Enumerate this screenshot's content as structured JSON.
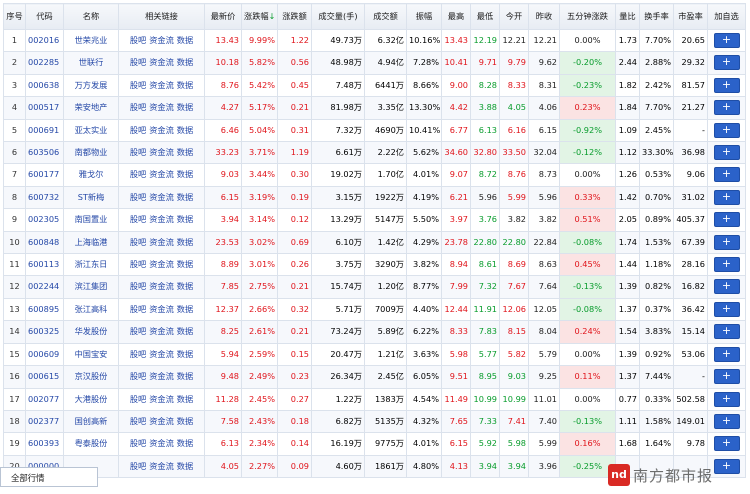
{
  "headers": [
    "序号",
    "代码",
    "名称",
    "相关链接",
    "最新价",
    "涨跌幅",
    "涨跌额",
    "成交量(手)",
    "成交额",
    "振幅",
    "最高",
    "最低",
    "今开",
    "昨收",
    "五分钟涨跌",
    "量比",
    "换手率",
    "市盈率",
    "加自选"
  ],
  "link_labels": [
    "股吧",
    "资金流",
    "数据"
  ],
  "sort_arrow": "↓",
  "add_label": "+",
  "rows": [
    {
      "idx": "1",
      "code": "002016",
      "name": "世荣兆业",
      "price": "13.43",
      "pct": "9.99%",
      "chg": "1.22",
      "vol": "49.73万",
      "amt": "6.32亿",
      "amp": "10.16%",
      "high": "13.43",
      "low": "12.19",
      "open": "12.21",
      "prev": "12.21",
      "min5": "0.00%",
      "vr": "1.73",
      "turn": "7.70%",
      "pe": "20.65",
      "d": "up",
      "d5": "flat",
      "dh": "up",
      "dl": "dn",
      "do": "flat"
    },
    {
      "idx": "2",
      "code": "002285",
      "name": "世联行",
      "price": "10.18",
      "pct": "5.82%",
      "chg": "0.56",
      "vol": "48.98万",
      "amt": "4.94亿",
      "amp": "7.28%",
      "high": "10.41",
      "low": "9.71",
      "open": "9.79",
      "prev": "9.62",
      "min5": "-0.20%",
      "vr": "2.44",
      "turn": "2.88%",
      "pe": "29.32",
      "d": "up",
      "d5": "dn",
      "dh": "up",
      "dl": "up",
      "do": "up"
    },
    {
      "idx": "3",
      "code": "000638",
      "name": "万方发展",
      "price": "8.76",
      "pct": "5.42%",
      "chg": "0.45",
      "vol": "7.48万",
      "amt": "6441万",
      "amp": "8.66%",
      "high": "9.00",
      "low": "8.28",
      "open": "8.33",
      "prev": "8.31",
      "min5": "-0.23%",
      "vr": "1.82",
      "turn": "2.42%",
      "pe": "81.57",
      "d": "up",
      "d5": "dn",
      "dh": "up",
      "dl": "dn",
      "do": "up"
    },
    {
      "idx": "4",
      "code": "000517",
      "name": "荣安地产",
      "price": "4.27",
      "pct": "5.17%",
      "chg": "0.21",
      "vol": "81.98万",
      "amt": "3.35亿",
      "amp": "13.30%",
      "high": "4.42",
      "low": "3.88",
      "open": "4.05",
      "prev": "4.06",
      "min5": "0.23%",
      "vr": "1.84",
      "turn": "7.70%",
      "pe": "21.27",
      "d": "up",
      "d5": "up",
      "dh": "up",
      "dl": "dn",
      "do": "dn"
    },
    {
      "idx": "5",
      "code": "000691",
      "name": "亚太实业",
      "price": "6.46",
      "pct": "5.04%",
      "chg": "0.31",
      "vol": "7.32万",
      "amt": "4690万",
      "amp": "10.41%",
      "high": "6.77",
      "low": "6.13",
      "open": "6.16",
      "prev": "6.15",
      "min5": "-0.92%",
      "vr": "1.09",
      "turn": "2.45%",
      "pe": "-",
      "d": "up",
      "d5": "dn",
      "dh": "up",
      "dl": "dn",
      "do": "up"
    },
    {
      "idx": "6",
      "code": "603506",
      "name": "南都物业",
      "price": "33.23",
      "pct": "3.71%",
      "chg": "1.19",
      "vol": "6.61万",
      "amt": "2.22亿",
      "amp": "5.62%",
      "high": "34.60",
      "low": "32.80",
      "open": "33.50",
      "prev": "32.04",
      "min5": "-0.12%",
      "vr": "1.12",
      "turn": "33.30%",
      "pe": "36.98",
      "d": "up",
      "d5": "dn",
      "dh": "up",
      "dl": "up",
      "do": "up"
    },
    {
      "idx": "7",
      "code": "600177",
      "name": "雅戈尔",
      "price": "9.03",
      "pct": "3.44%",
      "chg": "0.30",
      "vol": "19.02万",
      "amt": "1.70亿",
      "amp": "4.01%",
      "high": "9.07",
      "low": "8.72",
      "open": "8.76",
      "prev": "8.73",
      "min5": "0.00%",
      "vr": "1.26",
      "turn": "0.53%",
      "pe": "9.06",
      "d": "up",
      "d5": "flat",
      "dh": "up",
      "dl": "dn",
      "do": "up"
    },
    {
      "idx": "8",
      "code": "600732",
      "name": "ST新梅",
      "price": "6.15",
      "pct": "3.19%",
      "chg": "0.19",
      "vol": "3.15万",
      "amt": "1922万",
      "amp": "4.19%",
      "high": "6.21",
      "low": "5.96",
      "open": "5.99",
      "prev": "5.96",
      "min5": "0.33%",
      "vr": "1.42",
      "turn": "0.70%",
      "pe": "31.02",
      "d": "up",
      "d5": "up",
      "dh": "up",
      "dl": "flat",
      "do": "up"
    },
    {
      "idx": "9",
      "code": "002305",
      "name": "南国置业",
      "price": "3.94",
      "pct": "3.14%",
      "chg": "0.12",
      "vol": "13.29万",
      "amt": "5147万",
      "amp": "5.50%",
      "high": "3.97",
      "low": "3.76",
      "open": "3.82",
      "prev": "3.82",
      "min5": "0.51%",
      "vr": "2.05",
      "turn": "0.89%",
      "pe": "405.37",
      "d": "up",
      "d5": "up",
      "dh": "up",
      "dl": "dn",
      "do": "flat"
    },
    {
      "idx": "10",
      "code": "600848",
      "name": "上海临港",
      "price": "23.53",
      "pct": "3.02%",
      "chg": "0.69",
      "vol": "6.10万",
      "amt": "1.42亿",
      "amp": "4.29%",
      "high": "23.78",
      "low": "22.80",
      "open": "22.80",
      "prev": "22.84",
      "min5": "-0.08%",
      "vr": "1.74",
      "turn": "1.53%",
      "pe": "67.39",
      "d": "up",
      "d5": "dn",
      "dh": "up",
      "dl": "dn",
      "do": "dn"
    },
    {
      "idx": "11",
      "code": "600113",
      "name": "浙江东日",
      "price": "8.89",
      "pct": "3.01%",
      "chg": "0.26",
      "vol": "3.75万",
      "amt": "3290万",
      "amp": "3.82%",
      "high": "8.94",
      "low": "8.61",
      "open": "8.69",
      "prev": "8.63",
      "min5": "0.45%",
      "vr": "1.44",
      "turn": "1.18%",
      "pe": "28.16",
      "d": "up",
      "d5": "up",
      "dh": "up",
      "dl": "dn",
      "do": "up"
    },
    {
      "idx": "12",
      "code": "002244",
      "name": "滨江集团",
      "price": "7.85",
      "pct": "2.75%",
      "chg": "0.21",
      "vol": "15.74万",
      "amt": "1.20亿",
      "amp": "8.77%",
      "high": "7.99",
      "low": "7.32",
      "open": "7.67",
      "prev": "7.64",
      "min5": "-0.13%",
      "vr": "1.39",
      "turn": "0.82%",
      "pe": "16.82",
      "d": "up",
      "d5": "dn",
      "dh": "up",
      "dl": "dn",
      "do": "up"
    },
    {
      "idx": "13",
      "code": "600895",
      "name": "张江高科",
      "price": "12.37",
      "pct": "2.66%",
      "chg": "0.32",
      "vol": "5.71万",
      "amt": "7009万",
      "amp": "4.40%",
      "high": "12.44",
      "low": "11.91",
      "open": "12.06",
      "prev": "12.05",
      "min5": "-0.08%",
      "vr": "1.37",
      "turn": "0.37%",
      "pe": "36.42",
      "d": "up",
      "d5": "dn",
      "dh": "up",
      "dl": "dn",
      "do": "up"
    },
    {
      "idx": "14",
      "code": "600325",
      "name": "华发股份",
      "price": "8.25",
      "pct": "2.61%",
      "chg": "0.21",
      "vol": "73.24万",
      "amt": "5.89亿",
      "amp": "6.22%",
      "high": "8.33",
      "low": "7.83",
      "open": "8.15",
      "prev": "8.04",
      "min5": "0.24%",
      "vr": "1.54",
      "turn": "3.83%",
      "pe": "15.14",
      "d": "up",
      "d5": "up",
      "dh": "up",
      "dl": "dn",
      "do": "up"
    },
    {
      "idx": "15",
      "code": "000609",
      "name": "中国宝安",
      "price": "5.94",
      "pct": "2.59%",
      "chg": "0.15",
      "vol": "20.47万",
      "amt": "1.21亿",
      "amp": "3.63%",
      "high": "5.98",
      "low": "5.77",
      "open": "5.82",
      "prev": "5.79",
      "min5": "0.00%",
      "vr": "1.39",
      "turn": "0.92%",
      "pe": "53.06",
      "d": "up",
      "d5": "flat",
      "dh": "up",
      "dl": "dn",
      "do": "up"
    },
    {
      "idx": "16",
      "code": "000615",
      "name": "京汉股份",
      "price": "9.48",
      "pct": "2.49%",
      "chg": "0.23",
      "vol": "26.34万",
      "amt": "2.45亿",
      "amp": "6.05%",
      "high": "9.51",
      "low": "8.95",
      "open": "9.03",
      "prev": "9.25",
      "min5": "0.11%",
      "vr": "1.37",
      "turn": "7.44%",
      "pe": "-",
      "d": "up",
      "d5": "up",
      "dh": "up",
      "dl": "dn",
      "do": "dn"
    },
    {
      "idx": "17",
      "code": "002077",
      "name": "大港股份",
      "price": "11.28",
      "pct": "2.45%",
      "chg": "0.27",
      "vol": "1.22万",
      "amt": "1383万",
      "amp": "4.54%",
      "high": "11.49",
      "low": "10.99",
      "open": "10.99",
      "prev": "11.01",
      "min5": "0.00%",
      "vr": "0.77",
      "turn": "0.33%",
      "pe": "502.58",
      "d": "up",
      "d5": "flat",
      "dh": "up",
      "dl": "dn",
      "do": "dn"
    },
    {
      "idx": "18",
      "code": "002377",
      "name": "国创高新",
      "price": "7.58",
      "pct": "2.43%",
      "chg": "0.18",
      "vol": "6.82万",
      "amt": "5135万",
      "amp": "4.32%",
      "high": "7.65",
      "low": "7.33",
      "open": "7.41",
      "prev": "7.40",
      "min5": "-0.13%",
      "vr": "1.11",
      "turn": "1.58%",
      "pe": "149.01",
      "d": "up",
      "d5": "dn",
      "dh": "up",
      "dl": "dn",
      "do": "up"
    },
    {
      "idx": "19",
      "code": "600393",
      "name": "粤泰股份",
      "price": "6.13",
      "pct": "2.34%",
      "chg": "0.14",
      "vol": "16.19万",
      "amt": "9775万",
      "amp": "4.01%",
      "high": "6.15",
      "low": "5.92",
      "open": "5.98",
      "prev": "5.99",
      "min5": "0.16%",
      "vr": "1.68",
      "turn": "1.64%",
      "pe": "9.78",
      "d": "up",
      "d5": "up",
      "dh": "up",
      "dl": "dn",
      "do": "dn"
    },
    {
      "idx": "20",
      "code": "000000",
      "name": "",
      "price": "4.05",
      "pct": "2.27%",
      "chg": "0.09",
      "vol": "4.60万",
      "amt": "1861万",
      "amp": "4.80%",
      "high": "4.13",
      "low": "3.94",
      "open": "3.94",
      "prev": "3.96",
      "min5": "-0.25%",
      "vr": "",
      "turn": "",
      "pe": "",
      "d": "up",
      "d5": "dn",
      "dh": "up",
      "dl": "dn",
      "do": "dn"
    }
  ],
  "footer_tab": "全部行情",
  "watermark": {
    "logo": "nd",
    "text": "南方都市报"
  }
}
